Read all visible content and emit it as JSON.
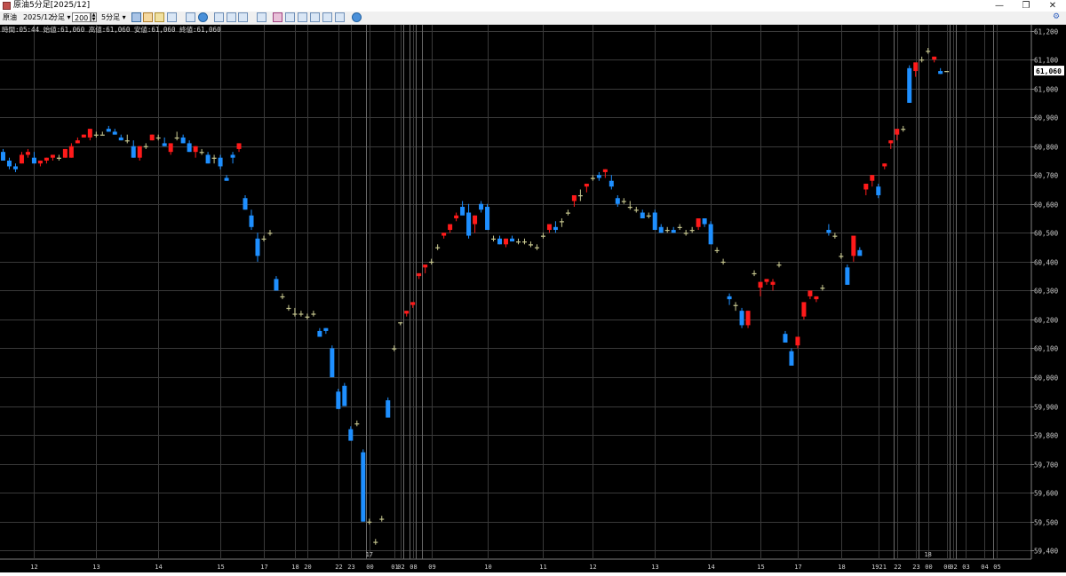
{
  "window": {
    "title": "原油5分足[2025/12]",
    "minimize_glyph": "—",
    "restore_glyph": "❐",
    "close_glyph": "✕"
  },
  "toolbar": {
    "symbol": "原油",
    "contract": "2025/12",
    "chart_type": "分足",
    "count": "200",
    "interval": "5分足",
    "tools": [
      "pointer",
      "hand",
      "pencil",
      "trend-line",
      "zoom",
      "chart-toggle",
      "grid",
      "table",
      "bar-chart",
      "compare",
      "chart-a",
      "chart-b",
      "chart-c",
      "chart-d",
      "chart-e",
      "settings"
    ]
  },
  "ohlc_readout": "時間:05:44 始値:61,060 高値:61,060 安値:61,060 終値:61,060",
  "current_price": "61,060",
  "colors": {
    "background": "#000000",
    "grid": "#3a3a3a",
    "up": "#ff1a1a",
    "down": "#1e8fff",
    "doji": "#c8c890",
    "text": "#d0d0d0",
    "price_tag_bg": "#ffffff"
  },
  "chart_data": {
    "type": "candlestick",
    "y_ticks": [
      "61,200",
      "61,100",
      "61,000",
      "60,900",
      "60,800",
      "60,700",
      "60,600",
      "60,500",
      "60,400",
      "60,300",
      "60,200",
      "60,100",
      "60,000",
      "59,900",
      "59,800",
      "59,700",
      "59,600",
      "59,500",
      "59,400"
    ],
    "y_tick_values": [
      61200,
      61100,
      61000,
      60900,
      60800,
      60700,
      60600,
      60500,
      60400,
      60300,
      60200,
      60100,
      60000,
      59900,
      59800,
      59700,
      59600,
      59500,
      59400
    ],
    "ylim": [
      59370,
      61220
    ],
    "n_bars": 166,
    "day_label": "17",
    "x_ticks": [
      {
        "i": 5,
        "label": "12"
      },
      {
        "i": 15,
        "label": "13"
      },
      {
        "i": 25,
        "label": "14"
      },
      {
        "i": 35,
        "label": "15"
      },
      {
        "i": 42,
        "label": "17"
      },
      {
        "i": 47,
        "label": "18"
      },
      {
        "i": 49,
        "label": "20"
      },
      {
        "i": 54,
        "label": "22"
      },
      {
        "i": 56,
        "label": "23"
      },
      {
        "i": 59,
        "label": "00"
      },
      {
        "i": 63,
        "label": "01"
      },
      {
        "i": 64,
        "label": "02"
      },
      {
        "i": 66,
        "label": "08"
      },
      {
        "i": 69,
        "label": "09"
      },
      {
        "i": 78,
        "label": "10"
      },
      {
        "i": 87,
        "label": "11"
      },
      {
        "i": 95,
        "label": "12"
      },
      {
        "i": 105,
        "label": "13"
      },
      {
        "i": 114,
        "label": "14"
      },
      {
        "i": 122,
        "label": "15"
      },
      {
        "i": 128,
        "label": "17"
      },
      {
        "i": 135,
        "label": "18"
      },
      {
        "i": 141,
        "label": "1921"
      },
      {
        "i": 144,
        "label": "22"
      },
      {
        "i": 147,
        "label": "23"
      },
      {
        "i": 149,
        "label": "00"
      },
      {
        "i": 152,
        "label": "00"
      },
      {
        "i": 153,
        "label": "02"
      },
      {
        "i": 155,
        "label": "03"
      },
      {
        "i": 158,
        "label": "04"
      },
      {
        "i": 160,
        "label": "05"
      }
    ],
    "separator_bars": [
      58.5,
      64.5,
      65.5,
      66.5,
      67.5,
      143.5,
      147.5,
      152.5,
      153.5,
      159.5
    ],
    "subday_label": {
      "i": 149,
      "label": "18"
    },
    "candles": [
      [
        60780,
        60790,
        60750,
        60750
      ],
      [
        60750,
        60760,
        60720,
        60730
      ],
      [
        60730,
        60740,
        60710,
        60720
      ],
      [
        60740,
        60780,
        60740,
        60770
      ],
      [
        60770,
        60790,
        60760,
        60780
      ],
      [
        60760,
        60780,
        60740,
        60740
      ],
      [
        60740,
        60750,
        60730,
        60750
      ],
      [
        60750,
        60760,
        60740,
        60760
      ],
      [
        60760,
        60770,
        60750,
        60770
      ],
      [
        60760,
        60770,
        60750,
        60760
      ],
      [
        60760,
        60790,
        60760,
        60790
      ],
      [
        60760,
        60810,
        60760,
        60800
      ],
      [
        60810,
        60830,
        60810,
        60820
      ],
      [
        60830,
        60840,
        60830,
        60840
      ],
      [
        60830,
        60860,
        60820,
        60860
      ],
      [
        60840,
        60850,
        60830,
        60840
      ],
      [
        60840,
        60850,
        60840,
        60840
      ],
      [
        60860,
        60870,
        60850,
        60850
      ],
      [
        60850,
        60860,
        60840,
        60840
      ],
      [
        60830,
        60840,
        60820,
        60820
      ],
      [
        60820,
        60840,
        60810,
        60820
      ],
      [
        60800,
        60820,
        60760,
        60760
      ],
      [
        60760,
        60800,
        60750,
        60800
      ],
      [
        60800,
        60810,
        60790,
        60800
      ],
      [
        60820,
        60840,
        60820,
        60840
      ],
      [
        60830,
        60840,
        60820,
        60830
      ],
      [
        60810,
        60830,
        60800,
        60800
      ],
      [
        60780,
        60810,
        60770,
        60810
      ],
      [
        60830,
        60850,
        60820,
        60830
      ],
      [
        60830,
        60840,
        60810,
        60810
      ],
      [
        60810,
        60820,
        60780,
        60780
      ],
      [
        60780,
        60800,
        60760,
        60800
      ],
      [
        60780,
        60790,
        60770,
        60780
      ],
      [
        60770,
        60780,
        60740,
        60740
      ],
      [
        60760,
        60770,
        60740,
        60760
      ],
      [
        60760,
        60770,
        60720,
        60730
      ],
      [
        60690,
        60700,
        60680,
        60680
      ],
      [
        60770,
        60780,
        60740,
        60760
      ],
      [
        60790,
        60810,
        60780,
        60810
      ],
      [
        60620,
        60630,
        60580,
        60580
      ],
      [
        60560,
        60580,
        60510,
        60520
      ],
      [
        60480,
        60500,
        60400,
        60420
      ],
      [
        60480,
        60490,
        60470,
        60480
      ],
      [
        60500,
        60510,
        60490,
        60500
      ],
      [
        60340,
        60350,
        60300,
        60300
      ],
      [
        60280,
        60290,
        60270,
        60280
      ],
      [
        60240,
        60250,
        60230,
        60240
      ],
      [
        60220,
        60240,
        60210,
        60220
      ],
      [
        60220,
        60230,
        60210,
        60220
      ],
      [
        60210,
        60220,
        60200,
        60210
      ],
      [
        60220,
        60230,
        60210,
        60220
      ],
      [
        60160,
        60170,
        60140,
        60140
      ],
      [
        60170,
        60170,
        60150,
        60160
      ],
      [
        60100,
        60110,
        60000,
        60000
      ],
      [
        59950,
        59960,
        59890,
        59890
      ],
      [
        59970,
        59980,
        59900,
        59900
      ],
      [
        59820,
        59830,
        59780,
        59780
      ],
      [
        59840,
        59850,
        59830,
        59840
      ],
      [
        59740,
        59750,
        59500,
        59500
      ],
      [
        59500,
        59510,
        59490,
        59500
      ],
      [
        59430,
        59440,
        59420,
        59430
      ],
      [
        59510,
        59520,
        59500,
        59510
      ],
      [
        59920,
        59930,
        59860,
        59860
      ],
      [
        60100,
        60110,
        60090,
        60100
      ],
      [
        60190,
        60190,
        60180,
        60190
      ],
      [
        60220,
        60230,
        60210,
        60230
      ],
      [
        60250,
        60260,
        60240,
        60260
      ],
      [
        60350,
        60360,
        60340,
        60360
      ],
      [
        60380,
        60390,
        60360,
        60390
      ],
      [
        60400,
        60410,
        60390,
        60400
      ],
      [
        60450,
        60460,
        60440,
        60450
      ],
      [
        60490,
        60500,
        60480,
        60500
      ],
      [
        60510,
        60530,
        60500,
        60530
      ],
      [
        60550,
        60570,
        60540,
        60560
      ],
      [
        60590,
        60610,
        60580,
        60560
      ],
      [
        60570,
        60600,
        60480,
        60490
      ],
      [
        60530,
        60560,
        60500,
        60560
      ],
      [
        60600,
        60610,
        60570,
        60580
      ],
      [
        60590,
        60600,
        60510,
        60510
      ],
      [
        60480,
        60490,
        60470,
        60480
      ],
      [
        60480,
        60490,
        60460,
        60460
      ],
      [
        60460,
        60480,
        60450,
        60480
      ],
      [
        60480,
        60490,
        60470,
        60470
      ],
      [
        60470,
        60480,
        60460,
        60470
      ],
      [
        60470,
        60480,
        60460,
        60470
      ],
      [
        60460,
        60470,
        60450,
        60460
      ],
      [
        60450,
        60460,
        60440,
        60450
      ],
      [
        60490,
        60500,
        60480,
        60490
      ],
      [
        60510,
        60530,
        60500,
        60530
      ],
      [
        60520,
        60540,
        60500,
        60510
      ],
      [
        60540,
        60550,
        60520,
        60540
      ],
      [
        60570,
        60580,
        60560,
        60570
      ],
      [
        60610,
        60630,
        60590,
        60630
      ],
      [
        60630,
        60650,
        60610,
        60630
      ],
      [
        60660,
        60670,
        60640,
        60670
      ],
      [
        60690,
        60700,
        60680,
        60690
      ],
      [
        60700,
        60710,
        60680,
        60690
      ],
      [
        60710,
        60720,
        60690,
        60720
      ],
      [
        60680,
        60700,
        60650,
        60660
      ],
      [
        60620,
        60630,
        60590,
        60600
      ],
      [
        60610,
        60620,
        60600,
        60610
      ],
      [
        60590,
        60610,
        60580,
        60590
      ],
      [
        60580,
        60590,
        60570,
        60580
      ],
      [
        60570,
        60580,
        60550,
        60550
      ],
      [
        60560,
        60570,
        60550,
        60560
      ],
      [
        60570,
        60580,
        60510,
        60510
      ],
      [
        60520,
        60530,
        60500,
        60500
      ],
      [
        60510,
        60520,
        60500,
        60510
      ],
      [
        60510,
        60520,
        60500,
        60500
      ],
      [
        60520,
        60530,
        60510,
        60520
      ],
      [
        60500,
        60510,
        60490,
        60500
      ],
      [
        60510,
        60520,
        60500,
        60510
      ],
      [
        60520,
        60550,
        60510,
        60550
      ],
      [
        60550,
        60550,
        60520,
        60530
      ],
      [
        60530,
        60540,
        60460,
        60460
      ],
      [
        60440,
        60450,
        60430,
        60440
      ],
      [
        60400,
        60410,
        60390,
        60400
      ],
      [
        60280,
        60290,
        60250,
        60270
      ],
      [
        60250,
        60260,
        60230,
        60250
      ],
      [
        60230,
        60240,
        60170,
        60180
      ],
      [
        60180,
        60230,
        60170,
        60230
      ],
      [
        60360,
        60370,
        60350,
        60360
      ],
      [
        60310,
        60320,
        60280,
        60330
      ],
      [
        60330,
        60340,
        60320,
        60340
      ],
      [
        60320,
        60340,
        60300,
        60330
      ],
      [
        60390,
        60400,
        60380,
        60390
      ],
      [
        60150,
        60160,
        60120,
        60120
      ],
      [
        60090,
        60100,
        60040,
        60040
      ],
      [
        60110,
        60120,
        60100,
        60140
      ],
      [
        60210,
        60220,
        60200,
        60260
      ],
      [
        60280,
        60290,
        60270,
        60300
      ],
      [
        60270,
        60280,
        60260,
        60280
      ],
      [
        60310,
        60320,
        60300,
        60310
      ],
      [
        60510,
        60530,
        60490,
        60500
      ],
      [
        60490,
        60500,
        60480,
        60490
      ],
      [
        60420,
        60430,
        60410,
        60420
      ],
      [
        60380,
        60390,
        60320,
        60320
      ],
      [
        60420,
        60480,
        60400,
        60490
      ],
      [
        60440,
        60450,
        60430,
        60420
      ],
      [
        60650,
        60670,
        60630,
        60670
      ],
      [
        60680,
        60700,
        60660,
        60700
      ],
      [
        60660,
        60670,
        60620,
        60630
      ],
      [
        60730,
        60740,
        60720,
        60740
      ],
      [
        60810,
        60820,
        60790,
        60820
      ],
      [
        60840,
        60850,
        60820,
        60860
      ],
      [
        60860,
        60870,
        60850,
        60860
      ],
      [
        61070,
        61080,
        60950,
        60950
      ],
      [
        61060,
        61070,
        61040,
        61090
      ],
      [
        61100,
        61110,
        61090,
        61100
      ],
      [
        61130,
        61140,
        61120,
        61130
      ],
      [
        61100,
        61110,
        61090,
        61110
      ],
      [
        61060,
        61070,
        61050,
        61050
      ],
      [
        61060,
        61060,
        61060,
        61060
      ]
    ]
  }
}
